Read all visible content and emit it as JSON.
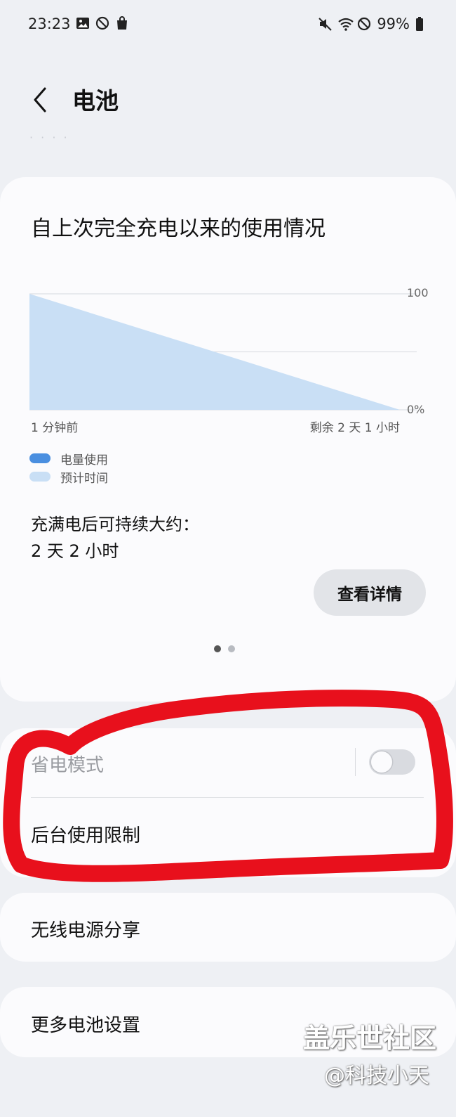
{
  "status_bar": {
    "time": "23:23",
    "battery_percent": "99%",
    "left_icons": [
      "gallery-icon",
      "blocked-notification-icon",
      "shopping-bag-icon"
    ],
    "right_icons": [
      "mute-icon",
      "wifi-icon",
      "do-not-disturb-icon",
      "battery-icon"
    ]
  },
  "header": {
    "title": "电池",
    "back_icon": "chevron-left-icon"
  },
  "usage_card": {
    "title": "自上次完全充电以来的使用情况",
    "chart_labels": {
      "y_top": "100",
      "y_bottom": "0%",
      "x_start": "1 分钟前",
      "x_end": "剩余 2 天 1 小时"
    },
    "legend": [
      {
        "label": "电量使用",
        "color": "#4a8fe0"
      },
      {
        "label": "预计时间",
        "color": "#c9dff5"
      }
    ],
    "lasts_label": "充满电后可持续大约：",
    "lasts_value": "2 天 2 小时",
    "details_button": "查看详情",
    "page_indicator": {
      "current": 1,
      "total": 2
    }
  },
  "chart_data": {
    "type": "area",
    "y_range": [
      0,
      100
    ],
    "series": [
      {
        "name": "预计时间",
        "color": "#c9dff5",
        "points": [
          [
            0,
            100
          ],
          [
            1,
            0
          ]
        ]
      }
    ],
    "x_tick_labels": [
      "1 分钟前",
      "剩余 2 天 1 小时"
    ],
    "y_tick_labels": [
      "100",
      "0%"
    ],
    "grid": true
  },
  "settings": {
    "power_saving_label": "省电模式",
    "power_saving_enabled": false,
    "background_limits_label": "后台使用限制",
    "wireless_share_label": "无线电源分享",
    "more_settings_label": "更多电池设置"
  },
  "annotation": {
    "color": "#e8101c"
  },
  "watermark": {
    "line1": "盖乐世社区",
    "line2": "@科技小天"
  }
}
